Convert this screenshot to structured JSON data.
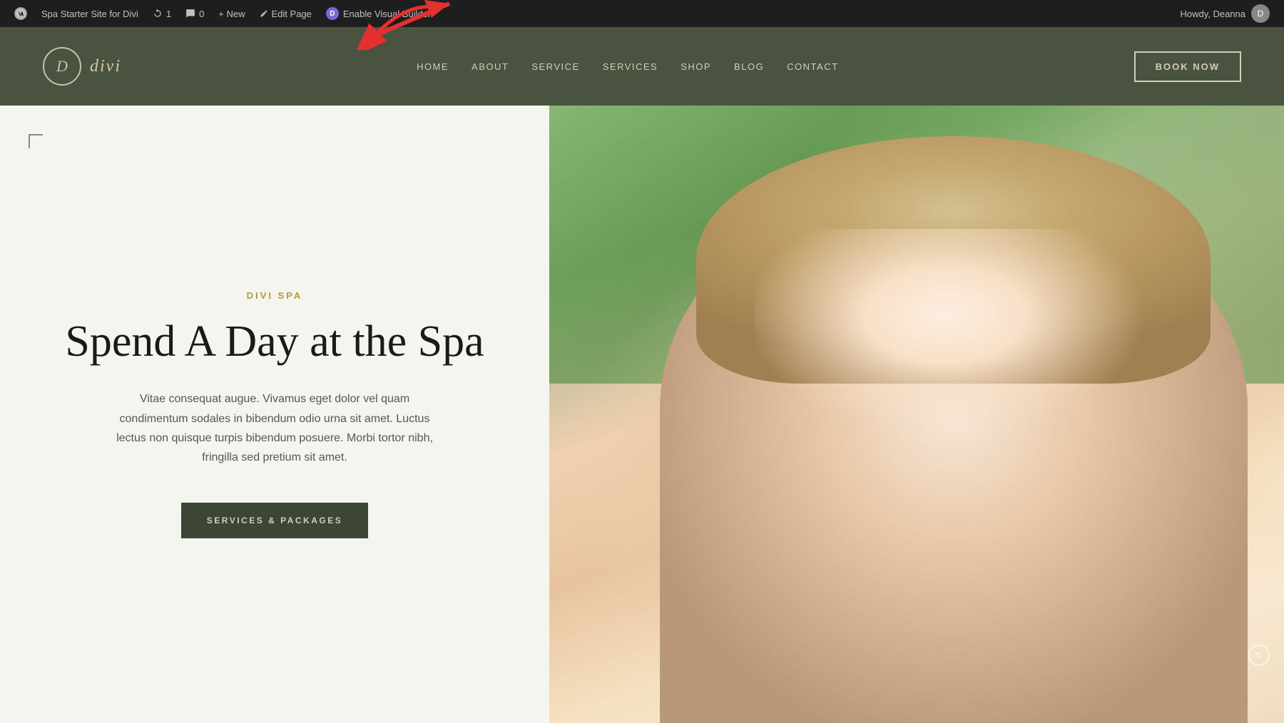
{
  "admin_bar": {
    "wp_icon": "wordpress",
    "site_name": "Spa Starter Site for Divi",
    "revisions_count": "1",
    "comments_count": "0",
    "new_label": "+ New",
    "edit_page_label": "Edit Page",
    "enable_visual_builder_label": "Enable Visual Builder",
    "divi_initial": "D",
    "howdy_label": "Howdy, Deanna",
    "avatar_initial": "D"
  },
  "nav": {
    "logo_letter": "D",
    "logo_text": "divi",
    "links": [
      {
        "label": "HOME",
        "id": "home"
      },
      {
        "label": "ABOUT",
        "id": "about"
      },
      {
        "label": "SERVICE",
        "id": "service"
      },
      {
        "label": "SERVICES",
        "id": "services"
      },
      {
        "label": "SHOP",
        "id": "shop"
      },
      {
        "label": "BLOG",
        "id": "blog"
      },
      {
        "label": "CONTACT",
        "id": "contact"
      }
    ],
    "book_now": "BOOK NOW"
  },
  "hero": {
    "subtitle": "DIVI SPA",
    "title": "Spend A Day at the Spa",
    "description": "Vitae consequat augue. Vivamus eget dolor vel quam condimentum sodales in bibendum odio urna sit amet. Luctus lectus non quisque turpis bibendum posuere. Morbi tortor nibh, fringilla sed pretium sit amet.",
    "cta_button": "SERVICES & PACKAGES"
  },
  "colors": {
    "admin_bar_bg": "#1e1e1e",
    "admin_bar_text": "#c2c2c2",
    "nav_bg": "#4a5240",
    "nav_text": "#d4cdb8",
    "hero_left_bg": "#f5f5f0",
    "hero_subtitle_color": "#b8973a",
    "hero_title_color": "#1a1a1a",
    "hero_desc_color": "#555555",
    "cta_bg": "#3d4535",
    "cta_text": "#d4cdb8"
  }
}
